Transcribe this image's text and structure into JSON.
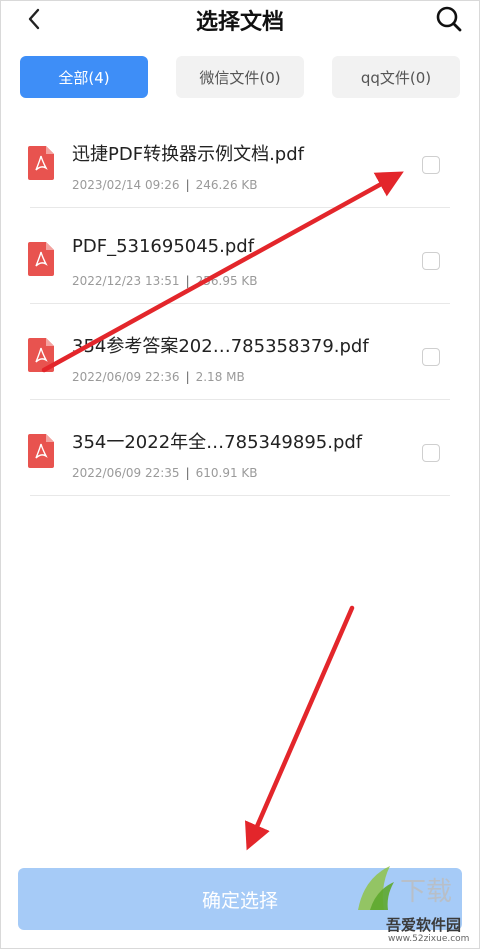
{
  "header": {
    "title": "选择文档",
    "back_icon": "chevron-left-icon",
    "search_icon": "search-icon"
  },
  "tabs": [
    {
      "label": "全部(4)",
      "active": true
    },
    {
      "label": "微信文件(0)",
      "active": false
    },
    {
      "label": "qq文件(0)",
      "active": false
    }
  ],
  "files": [
    {
      "name": "迅捷PDF转换器示例文档.pdf",
      "date": "2023/02/14 09:26",
      "size": "246.26 KB",
      "icon": "pdf-icon",
      "checked": false
    },
    {
      "name": "PDF_531695045.pdf",
      "date": "2022/12/23 13:51",
      "size": "256.95 KB",
      "icon": "pdf-icon",
      "checked": false
    },
    {
      "name": "354参考答案202…785358379.pdf",
      "date": "2022/06/09 22:36",
      "size": "2.18 MB",
      "icon": "pdf-icon",
      "checked": false
    },
    {
      "name": "354一2022年全…785349895.pdf",
      "date": "2022/06/09 22:35",
      "size": "610.91 KB",
      "icon": "pdf-icon",
      "checked": false
    }
  ],
  "confirm": {
    "label": "确定选择"
  },
  "watermark": {
    "name": "吾爱软件园",
    "url": "www.52zixue.com"
  },
  "colors": {
    "accent": "#3e8ef7",
    "confirm_disabled": "#a6cbf7",
    "pdf_red": "#e8534f",
    "annotation_arrow": "#e3262b"
  }
}
